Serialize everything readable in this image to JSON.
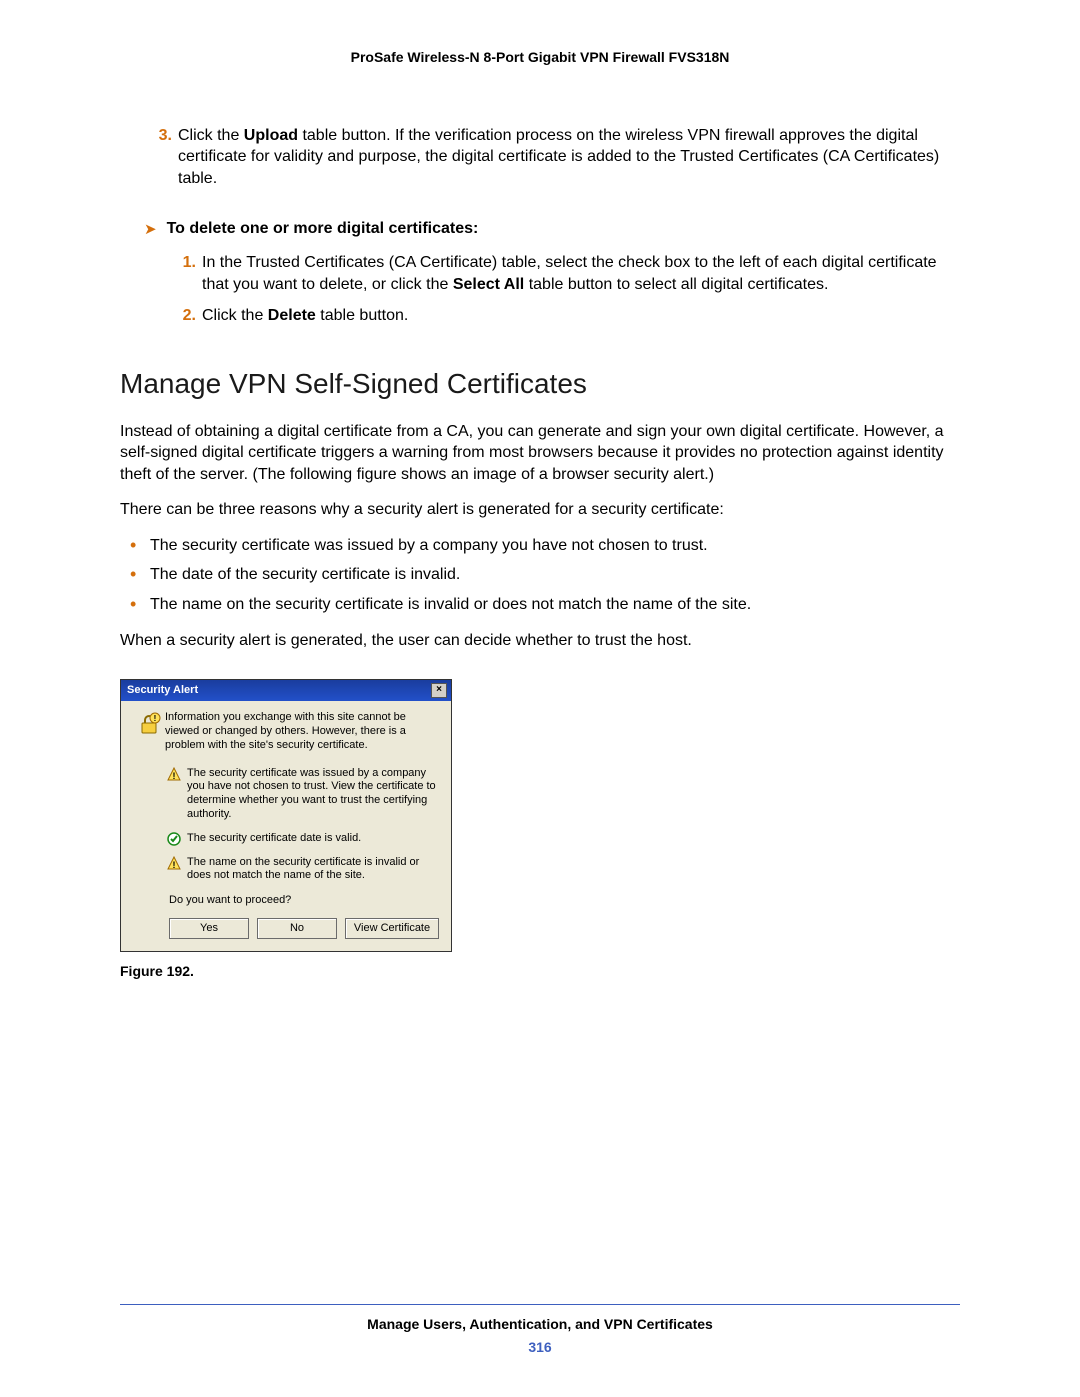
{
  "header": {
    "product": "ProSafe Wireless-N 8-Port Gigabit VPN Firewall FVS318N"
  },
  "step3": {
    "num": "3.",
    "pre": "Click the ",
    "bold": "Upload",
    "post": " table button. If the verification process on the wireless VPN firewall approves the digital certificate for validity and purpose, the digital certificate is added to the Trusted Certificates (CA Certificates) table."
  },
  "deleteHeading": "To delete one or more digital certificates:",
  "delStep1": {
    "num": "1.",
    "pre": "In the Trusted Certificates (CA Certificate) table, select the check box to the left of each digital certificate that you want to delete, or click the ",
    "bold": "Select All",
    "post": " table button to select all digital certificates."
  },
  "delStep2": {
    "num": "2.",
    "pre": "Click the ",
    "bold": "Delete",
    "post": " table button."
  },
  "sectionTitle": "Manage VPN Self-Signed Certificates",
  "para1": "Instead of obtaining a digital certificate from a CA, you can generate and sign your own digital certificate. However, a self-signed digital certificate triggers a warning from most browsers because it provides no protection against identity theft of the server. (The following figure shows an image of a browser security alert.)",
  "para2": "There can be three reasons why a security alert is generated for a security certificate:",
  "bullets": [
    "The security certificate was issued by a company you have not chosen to trust.",
    "The date of the security certificate is invalid.",
    "The name on the security certificate is invalid or does not match the name of the site."
  ],
  "para3": "When a security alert is generated, the user can decide whether to trust the host.",
  "dialog": {
    "title": "Security Alert",
    "close": "×",
    "intro": "Information you exchange with this site cannot be viewed or changed by others. However, there is a problem with the site's security certificate.",
    "item1": "The security certificate was issued by a company you have not chosen to trust. View the certificate to determine whether you want to trust the certifying authority.",
    "item2": "The security certificate date is valid.",
    "item3": "The name on the security certificate is invalid or does not match the name of the site.",
    "proceed": "Do you want to proceed?",
    "yes": "Yes",
    "no": "No",
    "view": "View Certificate"
  },
  "figureCaption": "Figure 192.",
  "footer": {
    "chapter": "Manage Users, Authentication, and VPN Certificates",
    "page": "316"
  }
}
